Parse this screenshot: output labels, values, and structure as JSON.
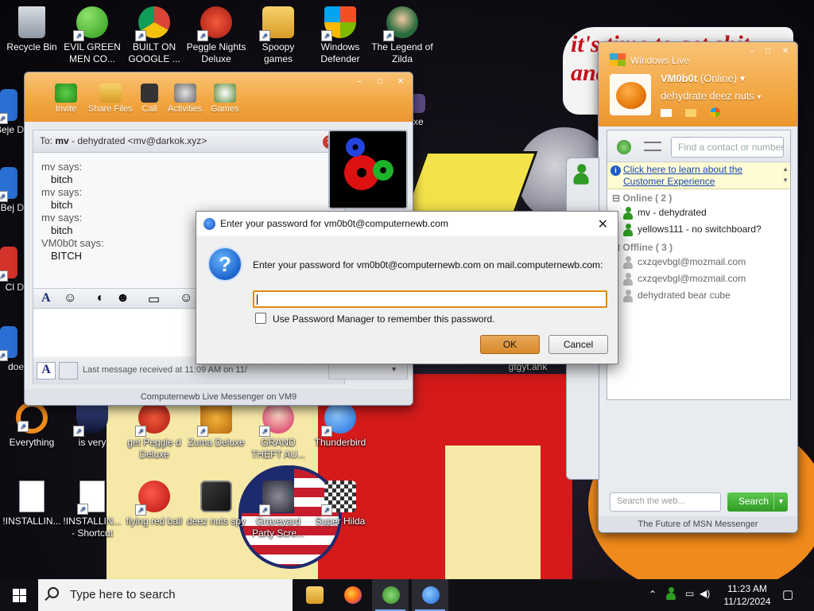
{
  "wallpaper": {
    "banner_text": "it's time to get shit and or t"
  },
  "desktop_icons": [
    {
      "label": "Recycle Bin",
      "icon": "recycle-bin-icon"
    },
    {
      "label": "EVIL GREEN MEN CO...",
      "icon": "messenger-people-icon"
    },
    {
      "label": "BUILT ON GOOGLE ...",
      "icon": "chrome-icon"
    },
    {
      "label": "Peggle Nights Deluxe",
      "icon": "peggle-icon"
    },
    {
      "label": "Spoopy games",
      "icon": "folder-icon"
    },
    {
      "label": "Windows Defender",
      "icon": "windows-defender-icon"
    },
    {
      "label": "The Legend of Zilda",
      "icon": "game-character-icon"
    },
    {
      "label": "Everything",
      "icon": "everything-search-icon"
    },
    {
      "label": "is very",
      "icon": "game-icon"
    },
    {
      "label": "get Peggle d Deluxe",
      "icon": "peggle-icon"
    },
    {
      "label": "Zuma Deluxe",
      "icon": "zuma-icon"
    },
    {
      "label": "GRAND THEFT AU...",
      "icon": "game-character-icon"
    },
    {
      "label": "Thunderbird",
      "icon": "thunderbird-icon"
    },
    {
      "label": "!INSTALLIN...",
      "icon": "document-icon"
    },
    {
      "label": "!INSTALLIN... - Shortcut",
      "icon": "document-icon"
    },
    {
      "label": "flying red ball",
      "icon": "angry-bird-icon"
    },
    {
      "label": "deez nuts spy",
      "icon": "windows-stack-icon"
    },
    {
      "label": "Graveyard Party Scre...",
      "icon": "game-character-icon"
    },
    {
      "label": "Super Hilda",
      "icon": "pixel-dog-icon"
    },
    {
      "label": "gtgyt.ahk",
      "icon": "ahk-file-icon"
    },
    {
      "label": "exe",
      "icon": "exe-icon"
    }
  ],
  "left_clipped_labels": [
    "Beje D",
    "Bej D",
    "Cl D",
    "doe"
  ],
  "chat_window": {
    "toolbar": [
      "Invite",
      "Share Files",
      "Call",
      "Activities",
      "Games"
    ],
    "to_prefix": "To:",
    "to_name": "mv",
    "to_rest": "- dehydrated <mv@darkok.xyz>",
    "messages": [
      {
        "who": "mv says:",
        "text": "bitch"
      },
      {
        "who": "mv says:",
        "text": "bitch"
      },
      {
        "who": "mv says:",
        "text": "bitch"
      },
      {
        "who": "VM0b0t says:",
        "text": "BITCH"
      }
    ],
    "last_message": "Last message received at 11:09 AM on 11/",
    "footer": "Computernewb Live Messenger on VM9"
  },
  "messenger": {
    "title": "Windows Live",
    "user_name": "VM0b0t",
    "status": "(Online)",
    "personal_message": "dehydrate deez nuts",
    "find_placeholder": "Find a contact or number",
    "info_link": "Click here to learn about the Customer Experience",
    "online_group": "Online ( 2 )",
    "offline_group": "Offline ( 3 )",
    "online_contacts": [
      "mv - dehydrated",
      "yellows111 - no switchboard?"
    ],
    "offline_contacts": [
      "cxzqevbgl@mozmail.com",
      "cxzqevbgl@mozmail.com",
      "dehydrated bear cube"
    ],
    "web_search_placeholder": "Search the web...",
    "search_button": "Search",
    "footer": "The Future of MSN Messenger"
  },
  "password_dialog": {
    "title": "Enter your password for vm0b0t@computernewb.com",
    "message": "Enter your password for vm0b0t@computernewb.com on mail.computernewb.com:",
    "checkbox_label": "Use Password Manager to remember this password.",
    "ok": "OK",
    "cancel": "Cancel"
  },
  "taskbar": {
    "search_placeholder": "Type here to search",
    "time": "11:23 AM",
    "date": "11/12/2024"
  },
  "colors": {
    "msn_orange": "#f2a640",
    "dialog_ok": "#d8892a",
    "search_green": "#2f9b24"
  }
}
